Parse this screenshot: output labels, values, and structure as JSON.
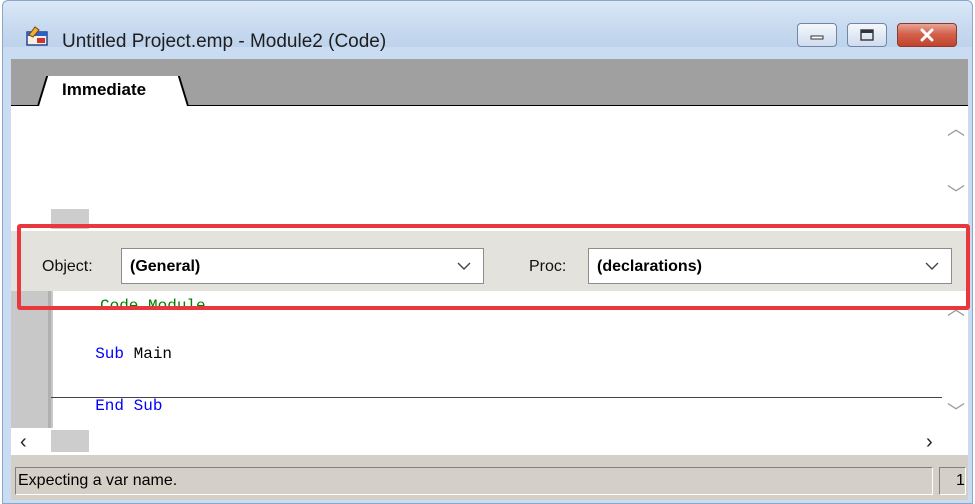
{
  "window": {
    "title": "Untitled Project.emp - Module2 (Code)",
    "icon": "project-app-icon",
    "buttons": {
      "minimize": "minimize-icon",
      "maximize": "maximize-icon",
      "close": "close-icon"
    }
  },
  "tabs": [
    {
      "label": "Immediate",
      "active": true
    }
  ],
  "object_bar": {
    "object_label": "Object:",
    "object_value": "(General)",
    "proc_label": "Proc:",
    "proc_value": "(declarations)"
  },
  "code": {
    "lines": [
      {
        "text": "Code Module",
        "kind": "comment"
      },
      {
        "keyword": "Sub",
        "text": " Main",
        "kind": "statement"
      },
      {
        "text": "",
        "kind": "blank"
      },
      {
        "keyword": "End Sub",
        "text": "",
        "kind": "statement"
      }
    ]
  },
  "status": {
    "message": "Expecting a var name.",
    "line_number": "1"
  },
  "colors": {
    "keyword": "#0000ff",
    "comment": "#008000",
    "highlight": "#e8383d"
  }
}
